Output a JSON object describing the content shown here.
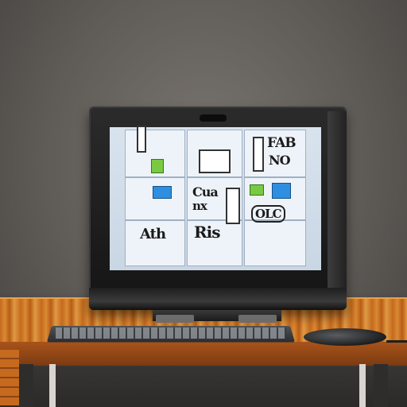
{
  "screen_text": {
    "top_right": "FAB",
    "top_right_2": "NO",
    "middle_center": "Cua",
    "middle_center_2": "nx",
    "middle_right": "OLC",
    "bottom_left": "Ath",
    "bottom_center": "Ris"
  },
  "icons": {
    "monitor": "monitor-icon",
    "keyboard": "keyboard-icon",
    "mouse": "mouse-icon"
  },
  "colors": {
    "desk": "#d07a28",
    "wall": "#6a6560",
    "screen": "#d9e3ee",
    "icon_green": "#7ac943",
    "icon_blue": "#2e8fe0"
  }
}
